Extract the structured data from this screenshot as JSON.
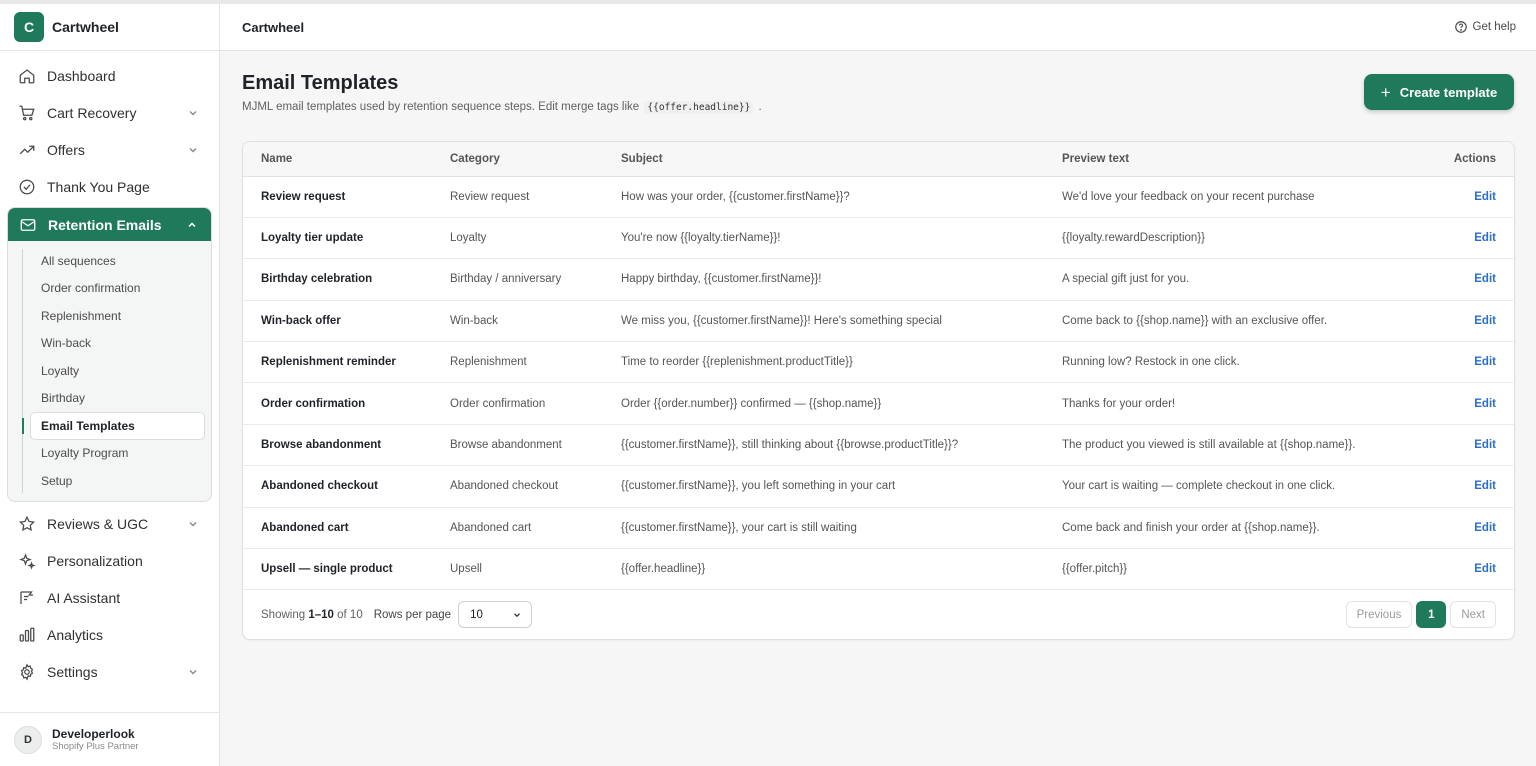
{
  "brand": {
    "logo_letter": "C",
    "name": "Cartwheel",
    "accent": "#1f7a5c"
  },
  "header": {
    "title": "Cartwheel",
    "help_label": "Get help"
  },
  "sidebar": {
    "items_top": [
      {
        "label": "Dashboard"
      },
      {
        "label": "Cart Recovery"
      },
      {
        "label": "Offers"
      },
      {
        "label": "Thank You Page"
      }
    ],
    "group": {
      "label": "Retention Emails",
      "sub_items": [
        {
          "label": "All sequences"
        },
        {
          "label": "Order confirmation"
        },
        {
          "label": "Replenishment"
        },
        {
          "label": "Win-back"
        },
        {
          "label": "Loyalty"
        },
        {
          "label": "Birthday"
        },
        {
          "label": "Email Templates"
        },
        {
          "label": "Loyalty Program"
        },
        {
          "label": "Setup"
        }
      ]
    },
    "items_bottom": [
      {
        "label": "Reviews & UGC"
      },
      {
        "label": "Personalization"
      },
      {
        "label": "AI Assistant"
      },
      {
        "label": "Analytics"
      },
      {
        "label": "Settings"
      }
    ],
    "user": {
      "initial": "D",
      "name": "Developerlook",
      "role": "Shopify Plus Partner"
    }
  },
  "page": {
    "title": "Email Templates",
    "subtitle_pre": "MJML email templates used by retention sequence steps. Edit merge tags like",
    "subtitle_code": "{{offer.headline}}",
    "subtitle_post": ".",
    "create_label": "Create template"
  },
  "table": {
    "columns": [
      "Name",
      "Category",
      "Subject",
      "Preview text",
      "Actions"
    ],
    "edit_label": "Edit",
    "rows": [
      {
        "name": "Review request",
        "category": "Review request",
        "subject": "How was your order, {{customer.firstName}}?",
        "preview": "We'd love your feedback on your recent purchase"
      },
      {
        "name": "Loyalty tier update",
        "category": "Loyalty",
        "subject": "You're now {{loyalty.tierName}}!",
        "preview": "{{loyalty.rewardDescription}}"
      },
      {
        "name": "Birthday celebration",
        "category": "Birthday / anniversary",
        "subject": "Happy birthday, {{customer.firstName}}!",
        "preview": "A special gift just for you."
      },
      {
        "name": "Win-back offer",
        "category": "Win-back",
        "subject": "We miss you, {{customer.firstName}}! Here's something special",
        "preview": "Come back to {{shop.name}} with an exclusive offer."
      },
      {
        "name": "Replenishment reminder",
        "category": "Replenishment",
        "subject": "Time to reorder {{replenishment.productTitle}}",
        "preview": "Running low? Restock in one click."
      },
      {
        "name": "Order confirmation",
        "category": "Order confirmation",
        "subject": "Order {{order.number}} confirmed — {{shop.name}}",
        "preview": "Thanks for your order!"
      },
      {
        "name": "Browse abandonment",
        "category": "Browse abandonment",
        "subject": "{{customer.firstName}}, still thinking about {{browse.productTitle}}?",
        "preview": "The product you viewed is still available at {{shop.name}}."
      },
      {
        "name": "Abandoned checkout",
        "category": "Abandoned checkout",
        "subject": "{{customer.firstName}}, you left something in your cart",
        "preview": "Your cart is waiting — complete checkout in one click."
      },
      {
        "name": "Abandoned cart",
        "category": "Abandoned cart",
        "subject": "{{customer.firstName}}, your cart is still waiting",
        "preview": "Come back and finish your order at {{shop.name}}."
      },
      {
        "name": "Upsell — single product",
        "category": "Upsell",
        "subject": "{{offer.headline}}",
        "preview": "{{offer.pitch}}"
      }
    ]
  },
  "pagination": {
    "showing_label": "Showing",
    "range": "1–10",
    "of_label": "of",
    "total": "10",
    "rows_per_page_label": "Rows per page",
    "rows_per_page_value": "10",
    "previous_label": "Previous",
    "current_page": "1",
    "next_label": "Next"
  }
}
